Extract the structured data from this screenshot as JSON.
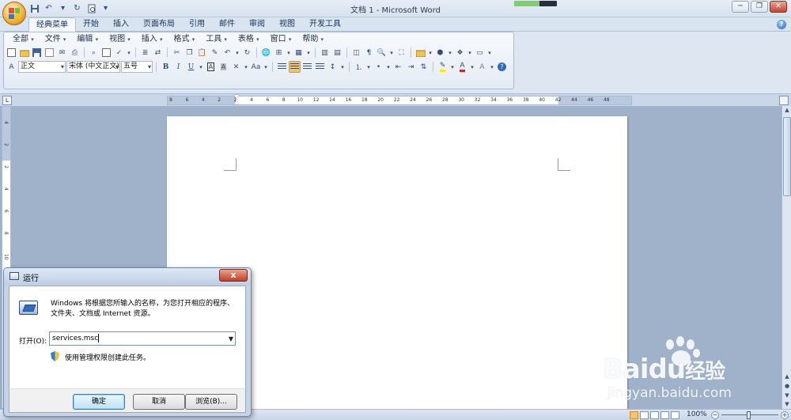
{
  "window": {
    "title": "文档 1 - Microsoft Word",
    "controls": [
      "─",
      "❐",
      "✕"
    ]
  },
  "quick_access": {
    "icons": [
      "save-icon",
      "undo-icon",
      "redo-icon",
      "print-preview-icon",
      "customize-icon"
    ]
  },
  "tabs": [
    {
      "label": "经典菜单",
      "active": true
    },
    {
      "label": "开始"
    },
    {
      "label": "插入"
    },
    {
      "label": "页面布局"
    },
    {
      "label": "引用"
    },
    {
      "label": "邮件"
    },
    {
      "label": "审阅"
    },
    {
      "label": "视图"
    },
    {
      "label": "开发工具"
    }
  ],
  "menu": [
    {
      "label": "全部"
    },
    {
      "label": "文件"
    },
    {
      "label": "编辑"
    },
    {
      "label": "视图"
    },
    {
      "label": "插入"
    },
    {
      "label": "格式"
    },
    {
      "label": "工具"
    },
    {
      "label": "表格"
    },
    {
      "label": "窗口"
    },
    {
      "label": "帮助"
    }
  ],
  "format_bar": {
    "style": "正文",
    "font": "宋体 (中文正文)",
    "size": "五号",
    "bold": "B",
    "italic": "I",
    "underline": "U",
    "font_a": "A",
    "case": "Aa"
  },
  "ruler": {
    "ticks": [
      "8",
      "6",
      "4",
      "2",
      "2",
      "4",
      "6",
      "8",
      "10",
      "12",
      "14",
      "16",
      "18",
      "20",
      "22",
      "24",
      "26",
      "28",
      "30",
      "32",
      "34",
      "36",
      "38",
      "40",
      "42",
      "44",
      "46",
      "48"
    ],
    "vticks": [
      "4",
      "2",
      "2",
      "4",
      "6",
      "8",
      "10"
    ]
  },
  "status": {
    "zoom": "100%",
    "minus": "−",
    "plus": "+"
  },
  "run_dialog": {
    "title": "运行",
    "close": "x",
    "description": "Windows 将根据您所输入的名称，为您打开相应的程序、文件夹、文档或 Internet 资源。",
    "open_label": "打开(O):",
    "open_value": "services.msc",
    "admin_note": "使用管理权限创建此任务。",
    "ok": "确定",
    "cancel": "取消",
    "browse": "浏览(B)..."
  },
  "watermark": {
    "brand": "Bai",
    "brand_tail": "du",
    "brand_cn": "经验",
    "url": "jingyan.baidu.com"
  },
  "colors": {
    "accent": "#2b579a",
    "ribbon": "#dde6f1",
    "workspace": "#9fb2ca"
  }
}
